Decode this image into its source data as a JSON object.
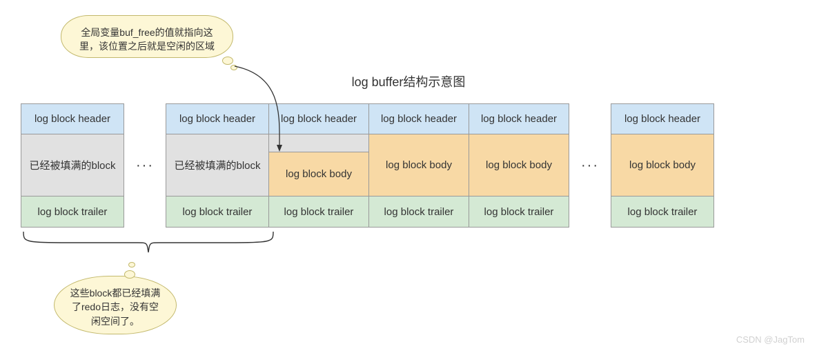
{
  "title": "log buffer结构示意图",
  "labels": {
    "header": "log block header",
    "body": "log block body",
    "trailer": "log block trailer",
    "filled": "已经被填满的block",
    "dots": "···"
  },
  "callouts": {
    "top": "全局变量buf_free的值就指向这里，该位置之后就是空闲的区域",
    "bottom": "这些block都已经填满了redo日志，没有空闲空间了。"
  },
  "chart_data": {
    "type": "diagram",
    "title": "log buffer结构示意图",
    "blocks_left_to_right": [
      {
        "header": "log block header",
        "body_state": "filled",
        "body_text": "已经被填满的block",
        "trailer": "log block trailer"
      },
      {
        "ellipsis": true
      },
      {
        "header": "log block header",
        "body_state": "filled",
        "body_text": "已经被填满的block",
        "trailer": "log block trailer"
      },
      {
        "header": "log block header",
        "body_state": "partial_free",
        "body_text": "log block body",
        "trailer": "log block trailer",
        "buf_free_points_here": true
      },
      {
        "header": "log block header",
        "body_state": "free",
        "body_text": "log block body",
        "trailer": "log block trailer"
      },
      {
        "header": "log block header",
        "body_state": "free",
        "body_text": "log block body",
        "trailer": "log block trailer"
      },
      {
        "ellipsis": true
      },
      {
        "header": "log block header",
        "body_state": "free",
        "body_text": "log block body",
        "trailer": "log block trailer"
      }
    ],
    "annotations": [
      {
        "target": "partial_free block top region",
        "text": "全局变量buf_free的值就指向这里，该位置之后就是空闲的区域"
      },
      {
        "target": "first two filled blocks (brace)",
        "text": "这些block都已经填满了redo日志，没有空闲空间了。"
      }
    ],
    "colors": {
      "header": "#cfe4f5",
      "body_free": "#f8d9a5",
      "body_filled": "#e1e1e1",
      "trailer": "#d4e9d4",
      "callout_bg": "#fdf7d6",
      "callout_border": "#c2b86b"
    }
  },
  "watermark": "CSDN @JagTom"
}
